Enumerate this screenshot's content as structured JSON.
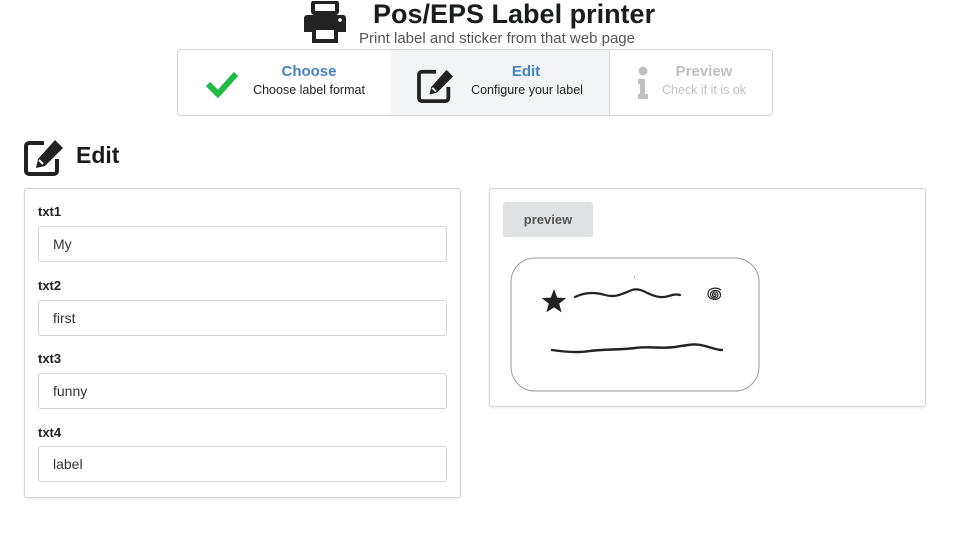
{
  "header": {
    "title": "Pos/EPS Label printer",
    "subtitle": "Print label and sticker from that web page",
    "icon": "printer-icon"
  },
  "steps": [
    {
      "title": "Choose",
      "description": "Choose label format",
      "icon": "checkmark-icon",
      "state": "completed"
    },
    {
      "title": "Edit",
      "description": "Configure your label",
      "icon": "edit-icon",
      "state": "active"
    },
    {
      "title": "Preview",
      "description": "Check if it is ok",
      "icon": "info-icon",
      "state": "disabled"
    }
  ],
  "section": {
    "title": "Edit",
    "icon": "edit-icon"
  },
  "form": {
    "fields": [
      {
        "label": "txt1",
        "value": "My"
      },
      {
        "label": "txt2",
        "value": "first"
      },
      {
        "label": "txt3",
        "value": "funny"
      },
      {
        "label": "txt4",
        "value": "label"
      }
    ]
  },
  "preview": {
    "button_label": "preview",
    "label_graphics": [
      "star-icon",
      "spiral-icon"
    ]
  },
  "colors": {
    "accent": "#4183c4",
    "check": "#21ba45",
    "disabled": "#c0c0c0",
    "border": "#d4d4d5",
    "active_step_bg": "#f3f4f5",
    "button_bg": "#e0e1e2"
  }
}
